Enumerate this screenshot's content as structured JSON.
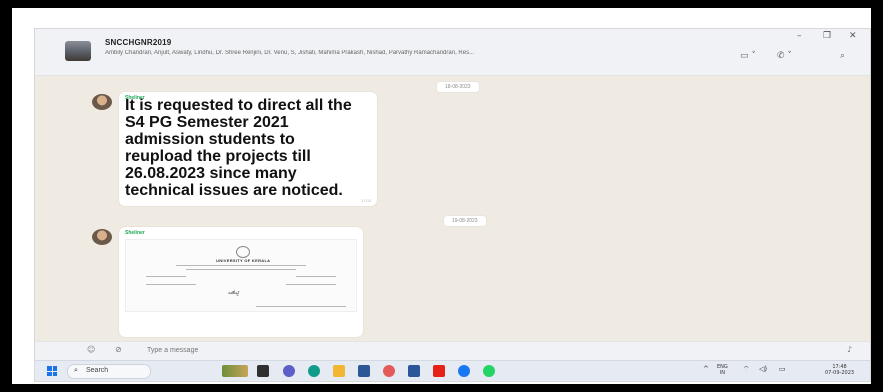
{
  "window": {
    "minimize": "–",
    "maximize": "❐",
    "close": "✕"
  },
  "header": {
    "group_name": "SNCCHGNR2019",
    "members": "Ambily Chandran, Anjult, Aswaty, Lindhu, Dr. Shree Renjini, Dr. Venu, S, Jishati, Mahima Prakash, Nishad, Parvathy Ramachandran, Res...",
    "video_icon": "video-call-icon",
    "call_icon": "phone-call-icon",
    "search_icon": "search-icon"
  },
  "chat": {
    "date1": "18-08-2023",
    "date2": "19-08-2023",
    "messages": [
      {
        "sender": "Sheliner",
        "text": "It is requested to direct all the S4 PG Semester 2021 admission students to reupload the projects till 26.08.2023 since many technical issues are noticed.",
        "time": "17:03"
      },
      {
        "sender": "Sheliner",
        "doc_title": "UNIVERSITY OF KERALA",
        "doc_heading": "പരിപ്പ്"
      }
    ]
  },
  "composer": {
    "placeholder": "Type a message",
    "emoji_icon": "emoji-icon",
    "attach_icon": "attach-icon",
    "mic_icon": "mic-icon"
  },
  "taskbar": {
    "search_label": "Search",
    "lang_top": "ENG",
    "lang_bottom": "IN",
    "time": "17:48",
    "date": "07-09-2023",
    "colors": {
      "accent": "#1a73e8",
      "whatsapp_green": "#25d366",
      "sender_green": "#1fa855"
    }
  }
}
